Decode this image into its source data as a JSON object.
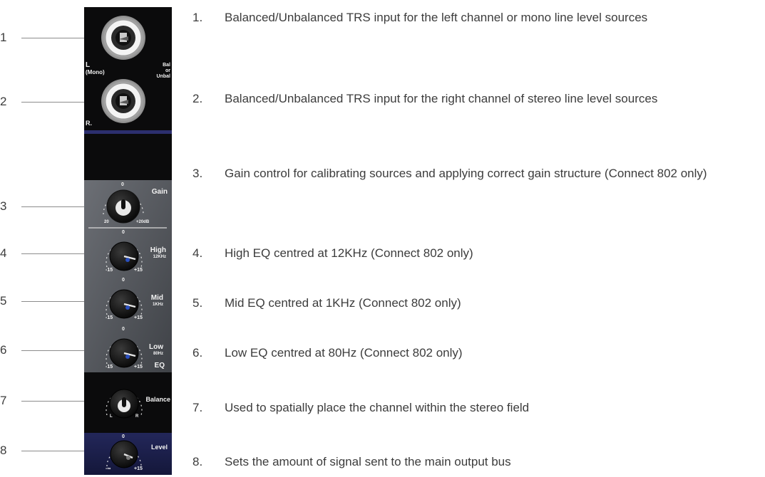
{
  "callouts": [
    "1",
    "2",
    "3",
    "4",
    "5",
    "6",
    "7",
    "8"
  ],
  "strip": {
    "input_l_label": "L",
    "input_l_sub": "(Mono)",
    "bal_label_1": "Bal",
    "bal_label_2": "or",
    "bal_label_3": "Unbal",
    "input_r_label": "R.",
    "gain_label": "Gain",
    "gain_top": "0",
    "gain_min": "20",
    "gain_max": "+20dB",
    "high_label": "High",
    "high_freq": "12KHz",
    "mid_label": "Mid",
    "mid_freq": "1KHz",
    "low_label": "Low",
    "low_freq": "80Hz",
    "eq_label": "EQ",
    "eq_top": "0",
    "eq_min": "-15",
    "eq_max": "+15",
    "balance_label": "Balance",
    "balance_l": "L",
    "balance_r": "R",
    "level_label": "Level",
    "level_top": "0",
    "level_min": "-∞",
    "level_max": "+15"
  },
  "items": [
    {
      "index": "1.",
      "text": "Balanced/Unbalanced TRS input for the left channel or mono line level sources"
    },
    {
      "index": "2.",
      "text": "Balanced/Unbalanced TRS input for the right channel of stereo line level sources"
    },
    {
      "index": "3.",
      "text": "Gain control for calibrating sources and applying correct gain structure (Connect 802 only)"
    },
    {
      "index": "4.",
      "text": "High EQ centred at 12KHz (Connect 802 only)"
    },
    {
      "index": "5.",
      "text": "Mid EQ centred at 1KHz (Connect 802 only)"
    },
    {
      "index": "6.",
      "text": "Low EQ centred at 80Hz (Connect 802 only)"
    },
    {
      "index": "7.",
      "text": "Used to spatially place the channel within the stereo field"
    },
    {
      "index": "8.",
      "text": "Sets the amount of signal sent to the main output bus"
    }
  ],
  "colors": {
    "strip_bg": "#0b0b0c",
    "eq_panel": "#5a5d63",
    "level_panel": "#1c1f4a",
    "divider_blue": "#2c2f6e",
    "text": "#3c3c3c",
    "line": "#8c8c8c"
  }
}
